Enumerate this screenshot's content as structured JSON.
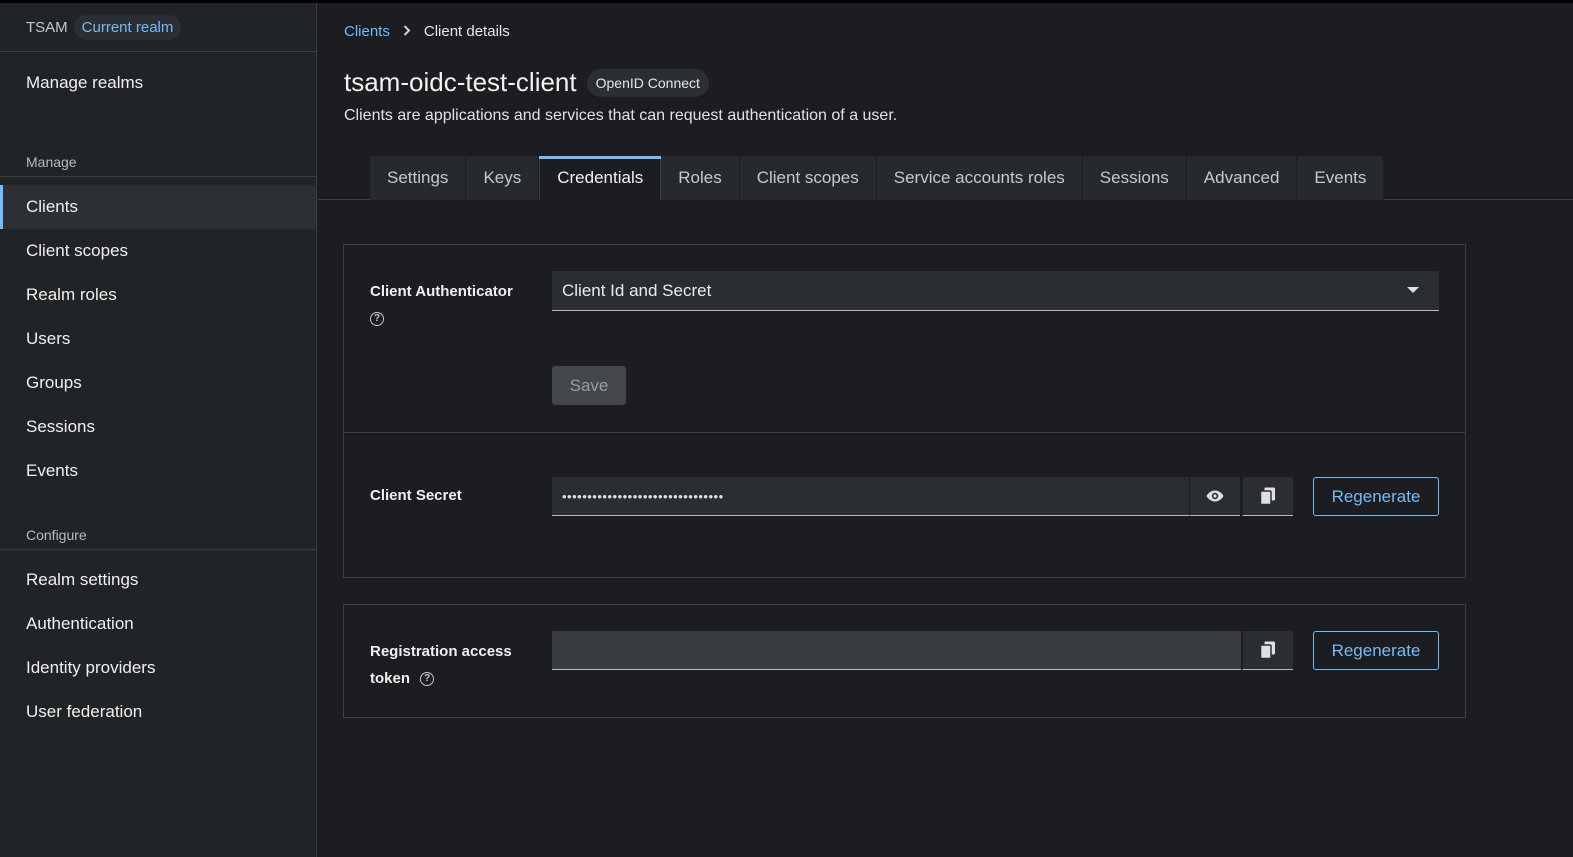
{
  "sidebar": {
    "realm_name": "TSAM",
    "realm_badge": "Current realm",
    "manage_realms": "Manage realms",
    "manage_label": "Manage",
    "manage_items": [
      {
        "label": "Clients"
      },
      {
        "label": "Client scopes"
      },
      {
        "label": "Realm roles"
      },
      {
        "label": "Users"
      },
      {
        "label": "Groups"
      },
      {
        "label": "Sessions"
      },
      {
        "label": "Events"
      }
    ],
    "configure_label": "Configure",
    "configure_items": [
      {
        "label": "Realm settings"
      },
      {
        "label": "Authentication"
      },
      {
        "label": "Identity providers"
      },
      {
        "label": "User federation"
      }
    ]
  },
  "breadcrumb": {
    "parent": "Clients",
    "current": "Client details"
  },
  "header": {
    "title": "tsam-oidc-test-client",
    "protocol_badge": "OpenID Connect",
    "subtitle": "Clients are applications and services that can request authentication of a user."
  },
  "tabs": [
    {
      "label": "Settings"
    },
    {
      "label": "Keys"
    },
    {
      "label": "Credentials"
    },
    {
      "label": "Roles"
    },
    {
      "label": "Client scopes"
    },
    {
      "label": "Service accounts roles"
    },
    {
      "label": "Sessions"
    },
    {
      "label": "Advanced"
    },
    {
      "label": "Events"
    }
  ],
  "active_tab": "Credentials",
  "credentials": {
    "authenticator_label": "Client Authenticator",
    "authenticator_value": "Client Id and Secret",
    "save_label": "Save",
    "secret_label": "Client Secret",
    "secret_masked": "••••••••••••••••••••••••••••••••",
    "regenerate_label": "Regenerate",
    "token_label_line1": "Registration access",
    "token_label_line2": "token",
    "token_value": "",
    "token_regenerate_label": "Regenerate"
  },
  "colors": {
    "accent": "#73bcf7",
    "background": "#1b1d21",
    "sidebar": "#212427"
  },
  "icons": {
    "help": "question-circle-icon",
    "reveal": "eye-icon",
    "copy": "copy-icon",
    "dropdown": "caret-down-icon",
    "breadcrumb_separator": "chevron-right-icon"
  }
}
